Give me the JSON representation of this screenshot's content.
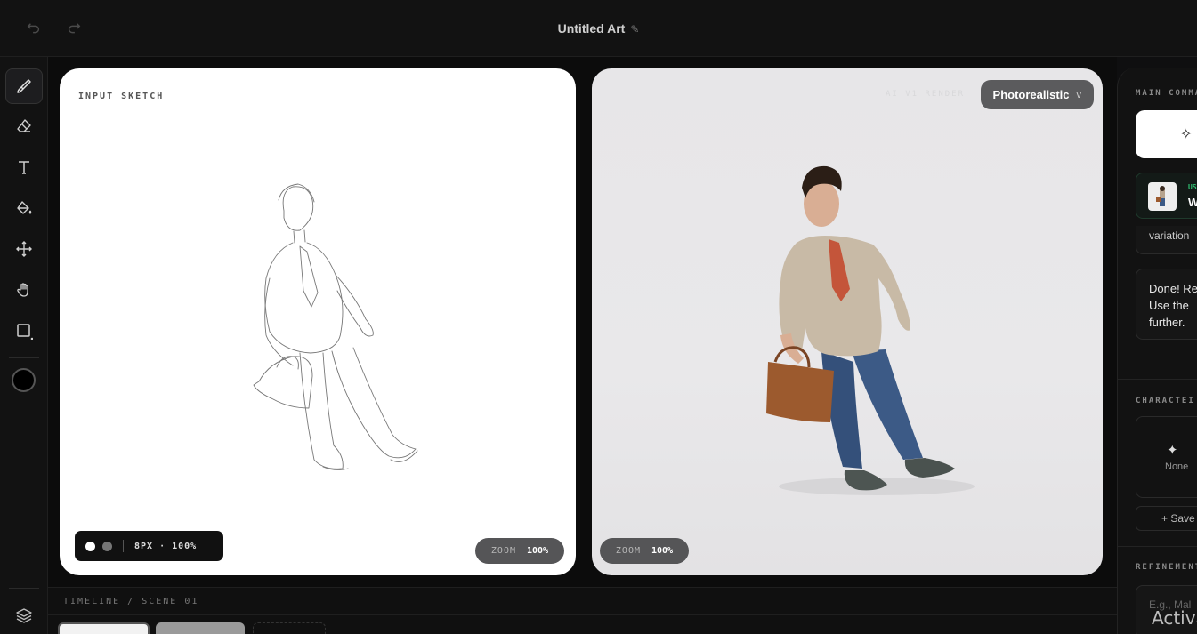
{
  "header": {
    "title": "Untitled Art",
    "undo_icon": "undo-icon",
    "redo_icon": "redo-icon",
    "edit_icon": "pencil-icon"
  },
  "toolbar": {
    "tools": [
      "brush-icon",
      "eraser-icon",
      "text-icon",
      "fill-bucket-icon",
      "move-icon",
      "hand-icon",
      "rectangle-icon"
    ],
    "active_tool": "brush-icon",
    "current_color": "#000000",
    "bottom_icon": "layers-icon"
  },
  "sketch_panel": {
    "label": "INPUT SKETCH",
    "brush_info": "8PX · 100%",
    "zoom_label": "ZOOM",
    "zoom_value": "100%"
  },
  "render_panel": {
    "faint_label": "AI V1 RENDER",
    "style_select": "Photorealistic",
    "style_chevron": "v",
    "zoom_label": "ZOOM",
    "zoom_value": "100%"
  },
  "timeline": {
    "label": "TIMELINE / SCENE_01"
  },
  "right_panel": {
    "main_label": "MAIN COMMA",
    "ref_tag": "US",
    "ref_name": "W",
    "chat_prev": "variation",
    "chat_lines": [
      "Done! Re",
      "Use the",
      "further."
    ],
    "characters_label": "CHARACTEI",
    "char_none": "None",
    "save_label": "+ Save",
    "refinement_label": "REFINEMENT",
    "refinement_placeholder": "E.g., Mal"
  },
  "overlay": {
    "activate": "Activa"
  },
  "colors": {
    "accent_green": "#2fbf71",
    "panel_bg": "#121212",
    "canvas_white": "#ffffff"
  }
}
